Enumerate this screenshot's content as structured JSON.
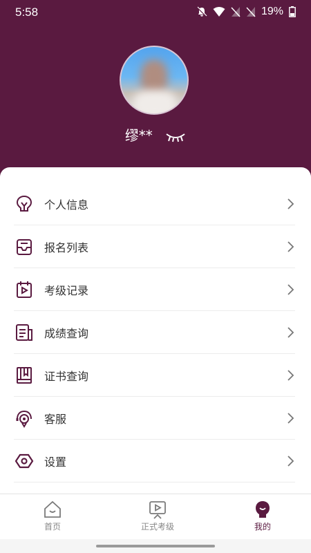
{
  "status_bar": {
    "time": "5:58",
    "battery": "19%"
  },
  "profile": {
    "name": "缪**"
  },
  "menu": [
    {
      "id": "personal-info",
      "label": "个人信息",
      "icon": "bulb-icon"
    },
    {
      "id": "registration-list",
      "label": "报名列表",
      "icon": "inbox-icon"
    },
    {
      "id": "exam-records",
      "label": "考级记录",
      "icon": "calendar-play-icon"
    },
    {
      "id": "score-query",
      "label": "成绩查询",
      "icon": "document-icon"
    },
    {
      "id": "certificate-query",
      "label": "证书查询",
      "icon": "book-icon"
    },
    {
      "id": "customer-service",
      "label": "客服",
      "icon": "headset-icon"
    },
    {
      "id": "settings",
      "label": "设置",
      "icon": "hexagon-icon"
    }
  ],
  "tabs": [
    {
      "id": "home",
      "label": "首页",
      "icon": "house-icon",
      "active": false
    },
    {
      "id": "formal-exam",
      "label": "正式考级",
      "icon": "screen-play-icon",
      "active": false
    },
    {
      "id": "mine",
      "label": "我的",
      "icon": "user-icon",
      "active": true
    }
  ],
  "colors": {
    "primary": "#5a1a40",
    "background": "#f5f5f5"
  }
}
